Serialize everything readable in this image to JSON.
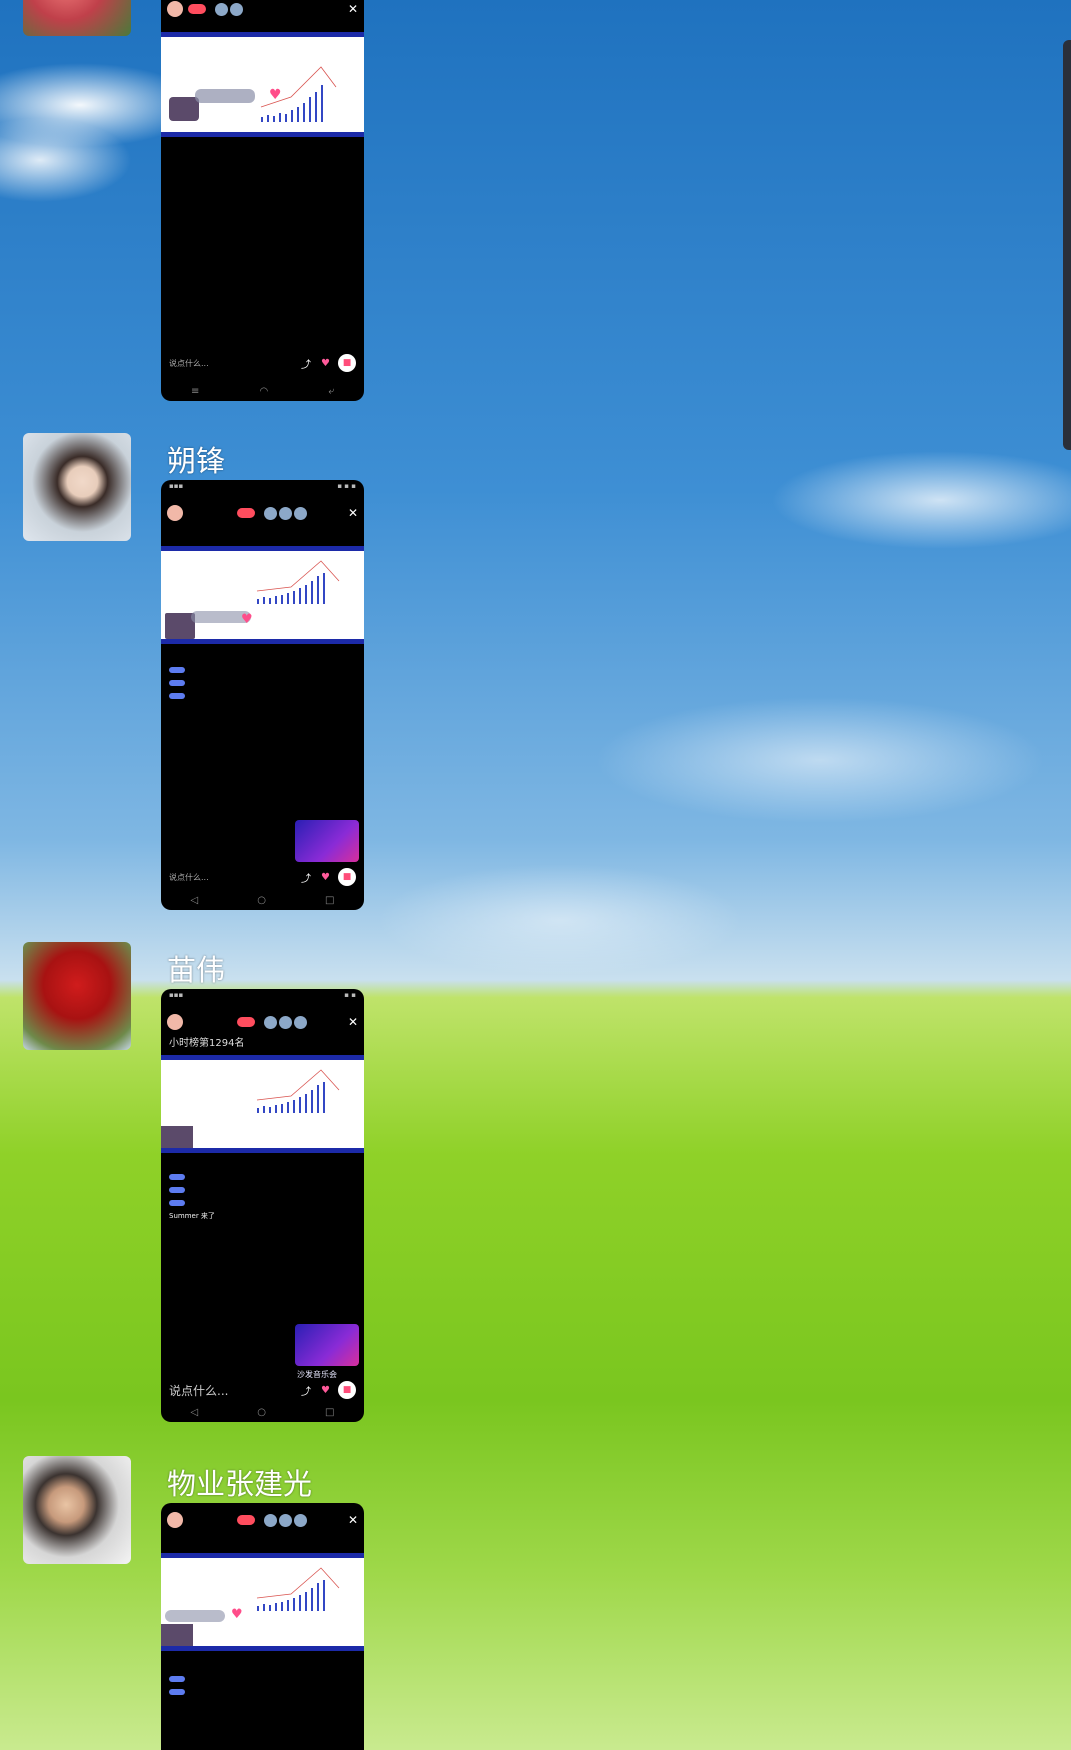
{
  "entries": [
    {
      "username": "",
      "avatar": "flower-avatar",
      "phone": {
        "rank": "",
        "chat": [
          "",
          "",
          "",
          "",
          "",
          "",
          ""
        ],
        "input_placeholder": "说点什么...",
        "promo": false,
        "nav": [
          "≡",
          "◠",
          "⤶"
        ]
      }
    },
    {
      "username": "朔锋",
      "avatar": "woman-scarf-avatar",
      "phone": {
        "rank": "",
        "chat": [
          "",
          "",
          "",
          "",
          "",
          "",
          "",
          "",
          ""
        ],
        "input_placeholder": "说点什么...",
        "promo": true,
        "nav": [
          "◁",
          "○",
          "□"
        ]
      }
    },
    {
      "username": "苗伟",
      "avatar": "red-tree-avatar",
      "phone": {
        "rank": "小时榜第1294名",
        "chat": [
          "",
          "",
          "",
          "",
          "",
          "",
          "",
          "",
          "Summer 来了"
        ],
        "promo_label": "沙发音乐会",
        "input_placeholder": "说点什么...",
        "promo": true,
        "nav": [
          "◁",
          "○",
          "□"
        ]
      }
    },
    {
      "username": "物业张建光",
      "avatar": "boy-avatar",
      "phone": {
        "rank": "",
        "chat": [
          "",
          ""
        ],
        "input_placeholder": "",
        "promo": false,
        "nav": []
      }
    }
  ],
  "colors": {
    "accent_pink": "#ff4d7a",
    "slide_band": "#1c2aa8",
    "username_text": "#ffffff"
  }
}
